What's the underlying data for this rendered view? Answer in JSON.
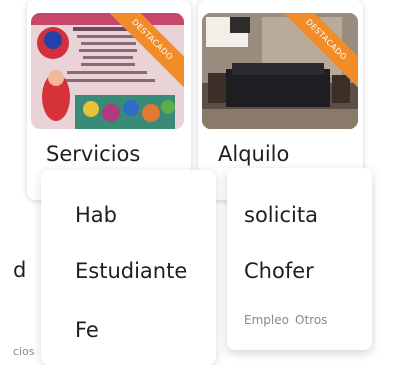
{
  "left_card": {
    "title": "Servicios",
    "badge": "DESTACADO",
    "image_icon": "collage-photo"
  },
  "right_card": {
    "title": "Alquilo",
    "badge": "DESTACADO",
    "image_icon": "bedroom-photo"
  },
  "left_panel": {
    "items": [
      "Hab",
      "Estudiante",
      "Fe"
    ]
  },
  "right_panel": {
    "items": [
      "solicita",
      "Chofer"
    ],
    "tags": [
      "Empleo",
      "Otros"
    ]
  },
  "edge_text": {
    "letter": "d",
    "small": "cios"
  },
  "colors": {
    "ribbon": "#f28c28"
  }
}
